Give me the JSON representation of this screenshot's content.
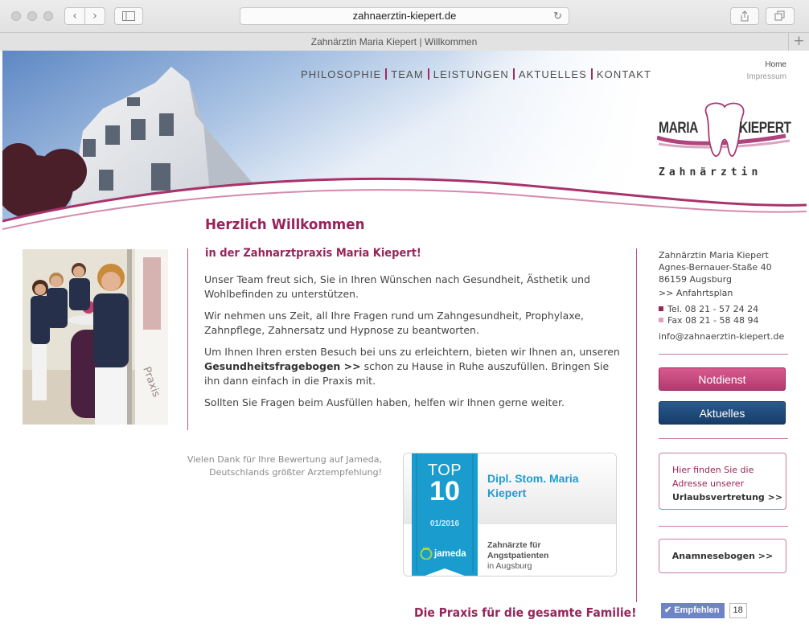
{
  "browser": {
    "url": "zahnaerztin-kiepert.de",
    "tab_title": "Zahnärztin Maria Kiepert | Willkommen"
  },
  "nav": {
    "items": [
      "PHILOSOPHIE",
      "TEAM",
      "LEISTUNGEN",
      "AKTUELLES",
      "KONTAKT"
    ],
    "home": "Home",
    "impressum": "Impressum"
  },
  "logo": {
    "first": "MARIA",
    "last": "KIEPERT",
    "subtitle": "Zahnärztin"
  },
  "main": {
    "heading": "Herzlich Willkommen",
    "subheading": "in der Zahnarztpraxis Maria Kiepert!",
    "p1": "Unser Team freut sich, Sie in Ihren Wünschen nach Gesundheit, Ästhetik und Wohlbefinden zu unterstützen.",
    "p2": "Wir nehmen uns Zeit, all Ihre Fragen rund um Zahngesundheit, Prophylaxe, Zahnpflege, Zahnersatz und Hypnose zu beantworten.",
    "p3_before": "Um Ihnen Ihren ersten Besuch bei uns zu erleichtern, bieten wir Ihnen an, unseren",
    "p3_link": "Gesundheitsfragebogen >>",
    "p3_after": "schon zu Hause in Ruhe auszufüllen. Bringen Sie ihn dann einfach in die Praxis mit.",
    "p4": "Sollten Sie Fragen beim Ausfüllen haben, helfen wir Ihnen gerne weiter.",
    "thanks_line1": "Vielen Dank für Ihre Bewertung auf Jameda,",
    "thanks_line2": "Deutschlands größter Arztempfehlung!",
    "family": "Die Praxis für die gesamte Familie!"
  },
  "jameda": {
    "top": "TOP",
    "rank": "10",
    "date": "01/2016",
    "brand": "jameda",
    "doctor": "Dipl. Stom. Maria Kiepert",
    "category1": "Zahnärzte für",
    "category2": "Angstpatienten",
    "location": "in Augsburg"
  },
  "sidebar": {
    "name": "Zahnärztin Maria Kiepert",
    "street": "Agnes-Bernauer-Staße 40",
    "city": "86159 Augsburg",
    "route": ">> Anfahrtsplan",
    "tel": "Tel. 08 21 - 57 24 24",
    "fax": "Fax 08 21 - 58 48 94",
    "email": "info@zahnaerztin-kiepert.de",
    "notdienst": "Notdienst",
    "aktuelles": "Aktuelles",
    "urlaub1": "Hier finden Sie die",
    "urlaub2": "Adresse unserer",
    "urlaub3": "Urlaubsvertretung >>",
    "anamnese": "Anamnesebogen >>",
    "empfehlen": "Empfehlen",
    "count": "18"
  },
  "colors": {
    "brand": "#98245a",
    "navy": "#163d69",
    "jameda_blue": "#1e9dd2"
  }
}
